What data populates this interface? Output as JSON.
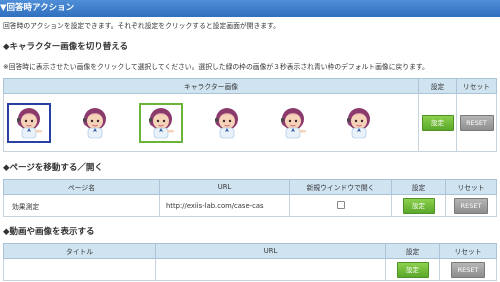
{
  "header": {
    "title": "▼回答時アクション"
  },
  "intro": "回答時のアクションを設定できます。それぞれ設定をクリックすると設定画面が開きます。",
  "character": {
    "heading": "◆キャラクター画像を切り替える",
    "note": "※回答時に表示させたい画像をクリックして選択してください。選択した緑の枠の画像が３秒表示され青い枠のデフォルト画像に戻ります。",
    "col_image": "キャラクター画像",
    "col_set": "設定",
    "col_reset": "リセット",
    "set_label": "設定",
    "reset_label": "RESET",
    "images": [
      {
        "name": "character-1",
        "selection": "default-blue"
      },
      {
        "name": "character-2",
        "selection": "none"
      },
      {
        "name": "character-3",
        "selection": "selected-green"
      },
      {
        "name": "character-4",
        "selection": "none"
      },
      {
        "name": "character-5",
        "selection": "none"
      },
      {
        "name": "character-6",
        "selection": "none"
      }
    ]
  },
  "page": {
    "heading": "◆ページを移動する／開く",
    "col_name": "ページ名",
    "col_url": "URL",
    "col_newwin": "新規ウインドウで開く",
    "col_set": "設定",
    "col_reset": "リセット",
    "row": {
      "name": "効果測定",
      "url": "http://exiis-lab.com/case-cas",
      "new_window": false
    },
    "set_label": "設定",
    "reset_label": "RESET"
  },
  "media": {
    "heading": "◆動画や画像を表示する",
    "col_title": "タイトル",
    "col_url": "URL",
    "col_set": "設定",
    "col_reset": "リセット",
    "row": {
      "title": "",
      "url": ""
    },
    "set_label": "設定",
    "reset_label": "RESET"
  },
  "colors": {
    "header": "#3a7bc8",
    "set_button": "#6cba34",
    "reset_button": "#9e9e9e",
    "table_head": "#cfe3f1"
  }
}
